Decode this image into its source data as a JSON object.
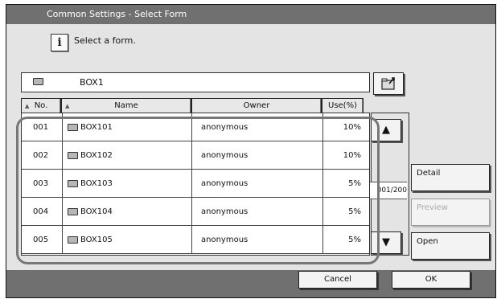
{
  "window": {
    "title": "Common Settings - Select Form"
  },
  "message": {
    "icon": "info-icon",
    "text": "Select a form."
  },
  "path": {
    "label": "BOX1",
    "icon": "folder-icon"
  },
  "table": {
    "columns": {
      "no": "No.",
      "name": "Name",
      "owner": "Owner",
      "use": "Use(%)"
    },
    "rows": [
      {
        "no": "001",
        "name": "BOX101",
        "owner": "anonymous",
        "use": "10%"
      },
      {
        "no": "002",
        "name": "BOX102",
        "owner": "anonymous",
        "use": "10%"
      },
      {
        "no": "003",
        "name": "BOX103",
        "owner": "anonymous",
        "use": "5%"
      },
      {
        "no": "004",
        "name": "BOX104",
        "owner": "anonymous",
        "use": "5%"
      },
      {
        "no": "005",
        "name": "BOX105",
        "owner": "anonymous",
        "use": "5%"
      }
    ]
  },
  "scroll": {
    "page_text": "001/200"
  },
  "buttons": {
    "detail": "Detail",
    "preview": "Preview",
    "open": "Open",
    "cancel": "Cancel",
    "ok": "OK"
  },
  "colors": {
    "title_bar": "#707070",
    "panel": "#e4e4e4",
    "highlight": "#777777"
  }
}
